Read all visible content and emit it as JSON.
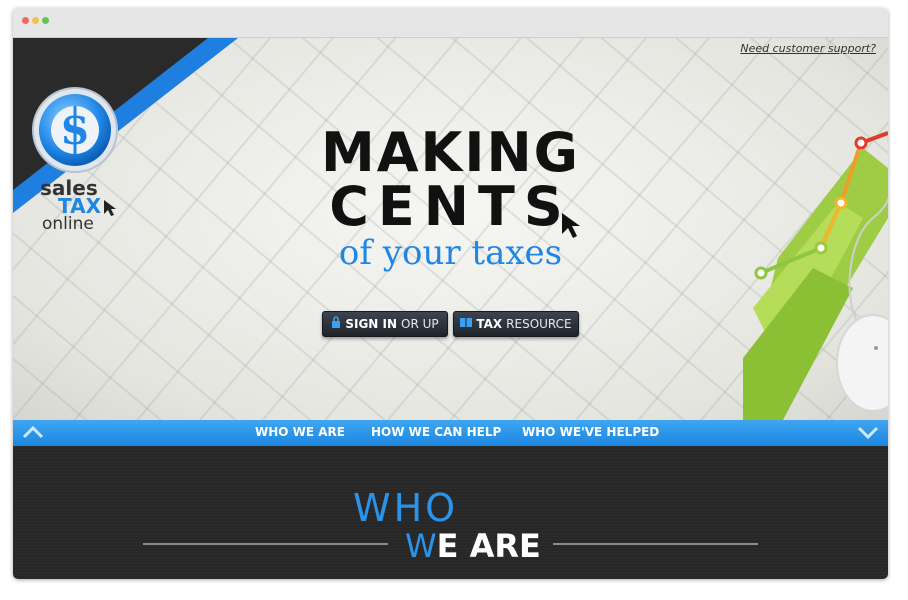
{
  "browser": {
    "dots": [
      "#ec6a5e",
      "#f4bf4f",
      "#61c554"
    ]
  },
  "header": {
    "support_link": "Need customer support?"
  },
  "logo": {
    "line1": "sales",
    "line2": "TAX",
    "line3": "online"
  },
  "hero": {
    "headline_line1": "MAKING",
    "headline_line2": "CENTS",
    "headline_line3": "of your taxes"
  },
  "buttons": {
    "signin_bold": "SIGN IN",
    "signin_rest": "OR UP",
    "resource_bold": "TAX",
    "resource_rest": "RESOURCE"
  },
  "nav": {
    "items": [
      "WHO WE ARE",
      "HOW WE CAN HELP",
      "WHO WE'VE HELPED"
    ]
  },
  "section": {
    "title_who": "WHO",
    "title_we": "W",
    "title_rest": "E ARE"
  },
  "colors": {
    "accent_blue": "#2a93ea",
    "dark_bg": "#272727",
    "graph_green": "#9acb3c"
  }
}
